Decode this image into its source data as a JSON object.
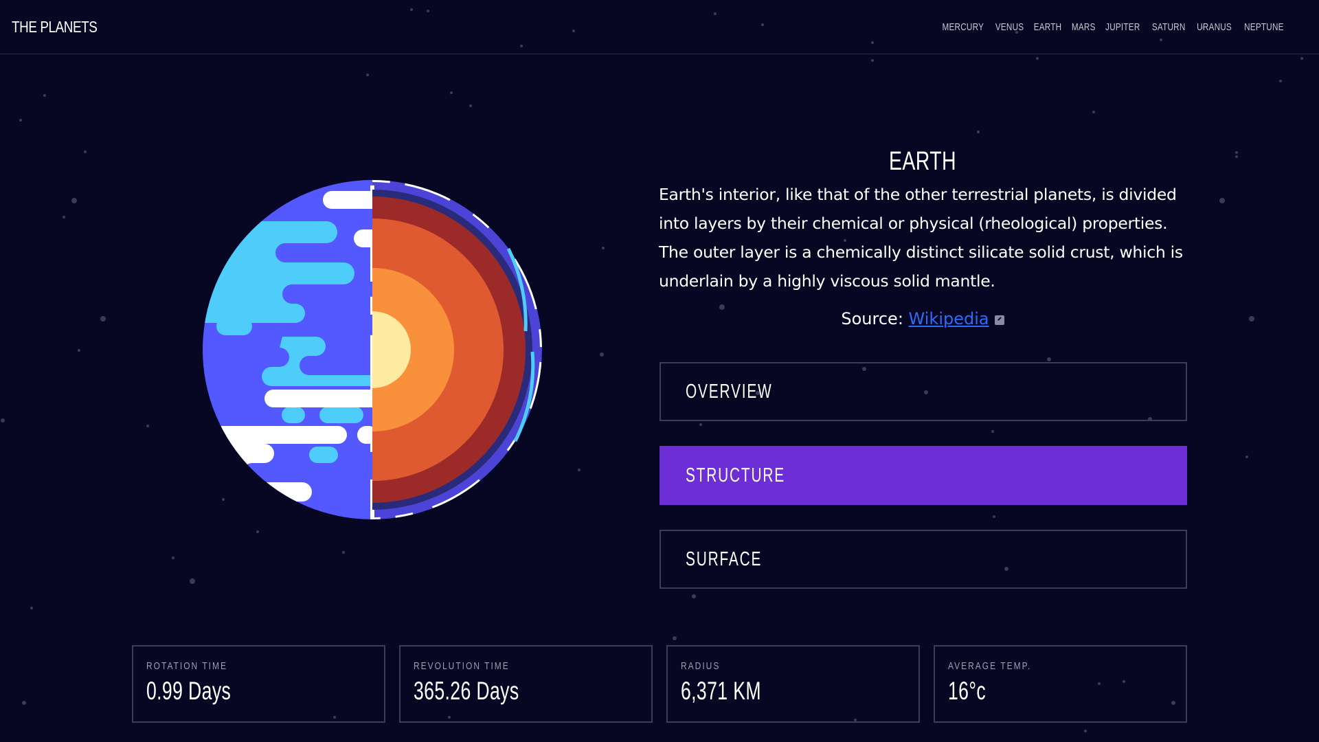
{
  "header": {
    "logo": "THE PLANETS",
    "nav": [
      "MERCURY",
      "VENUS",
      "EARTH",
      "MARS",
      "JUPITER",
      "SATURN",
      "URANUS",
      "NEPTUNE"
    ]
  },
  "planet": {
    "name": "EARTH",
    "description": "Earth's interior, like that of the other terrestrial planets, is divided into layers by their chemical or physical (rheological) properties. The outer layer is a chemically distinct silicate solid crust, which is underlain by a highly viscous solid mantle.",
    "source_prefix": "Source: ",
    "source_link": "Wikipedia",
    "image": "earth-internal-structure-illustration"
  },
  "tabs": [
    {
      "label": "OVERVIEW",
      "active": false
    },
    {
      "label": "STRUCTURE",
      "active": true
    },
    {
      "label": "SURFACE",
      "active": false
    }
  ],
  "stats": [
    {
      "label": "ROTATION TIME",
      "value": "0.99 Days"
    },
    {
      "label": "REVOLUTION TIME",
      "value": "365.26 Days"
    },
    {
      "label": "RADIUS",
      "value": "6,371 KM"
    },
    {
      "label": "AVERAGE TEMP.",
      "value": "16°c"
    }
  ],
  "colors": {
    "background": "#070724",
    "accent": "#6d2ed5",
    "link": "#2b6cff",
    "border": "#3c3c58"
  }
}
